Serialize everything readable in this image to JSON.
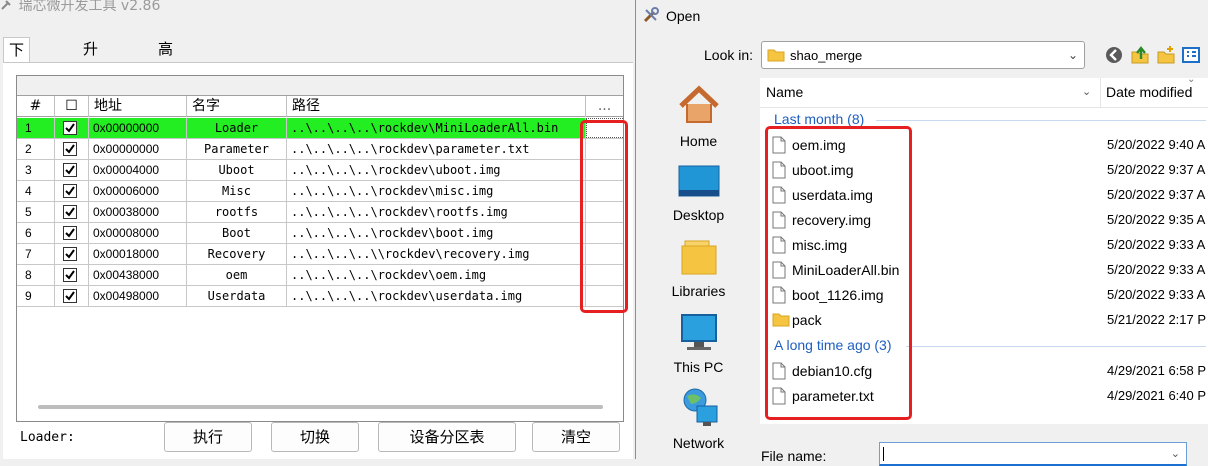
{
  "tool": {
    "title": "瑞芯微开发工具 v2.86",
    "tabs": [
      "下载镜像",
      "升级固件",
      "高级功能"
    ],
    "columns": {
      "num": "#",
      "check": "☐",
      "addr": "地址",
      "name": "名字",
      "path": "路径",
      "extra": "..."
    },
    "rows": [
      {
        "num": "1",
        "addr": "0x00000000",
        "name": "Loader",
        "path": "..\\..\\..\\..\\rockdev\\MiniLoaderAll.bin",
        "checked": true,
        "selected": true
      },
      {
        "num": "2",
        "addr": "0x00000000",
        "name": "Parameter",
        "path": "..\\..\\..\\..\\rockdev\\parameter.txt",
        "checked": true
      },
      {
        "num": "3",
        "addr": "0x00004000",
        "name": "Uboot",
        "path": "..\\..\\..\\..\\rockdev\\uboot.img",
        "checked": true
      },
      {
        "num": "4",
        "addr": "0x00006000",
        "name": "Misc",
        "path": "..\\..\\..\\..\\rockdev\\misc.img",
        "checked": true
      },
      {
        "num": "5",
        "addr": "0x00038000",
        "name": "rootfs",
        "path": "..\\..\\..\\..\\rockdev\\rootfs.img",
        "checked": true
      },
      {
        "num": "6",
        "addr": "0x00008000",
        "name": "Boot",
        "path": "..\\..\\..\\..\\rockdev\\boot.img",
        "checked": true
      },
      {
        "num": "7",
        "addr": "0x00018000",
        "name": "Recovery",
        "path": "..\\..\\..\\..\\\\rockdev\\recovery.img",
        "checked": true
      },
      {
        "num": "8",
        "addr": "0x00438000",
        "name": "oem",
        "path": "..\\..\\..\\..\\rockdev\\oem.img",
        "checked": true
      },
      {
        "num": "9",
        "addr": "0x00498000",
        "name": "Userdata",
        "path": "..\\..\\..\\..\\rockdev\\userdata.img",
        "checked": true
      }
    ],
    "loader_label": "Loader:",
    "buttons": {
      "run": "执行",
      "switch": "切换",
      "partition": "设备分区表",
      "clear": "清空"
    },
    "colors": {
      "selected_row": "#22ee22",
      "highlight_box": "#e62020"
    }
  },
  "dialog": {
    "title": "Open",
    "look_in_label": "Look in:",
    "look_in_value": "shao_merge",
    "places": [
      "Home",
      "Desktop",
      "Libraries",
      "This PC",
      "Network"
    ],
    "columns": {
      "name": "Name",
      "date": "Date modified"
    },
    "groups": [
      {
        "label": "Last month (8)",
        "files": [
          {
            "name": "oem.img",
            "date": "5/20/2022 9:40 A",
            "type": "file"
          },
          {
            "name": "uboot.img",
            "date": "5/20/2022 9:37 A",
            "type": "file"
          },
          {
            "name": "userdata.img",
            "date": "5/20/2022 9:37 A",
            "type": "file"
          },
          {
            "name": "recovery.img",
            "date": "5/20/2022 9:35 A",
            "type": "file"
          },
          {
            "name": "misc.img",
            "date": "5/20/2022 9:33 A",
            "type": "file"
          },
          {
            "name": "MiniLoaderAll.bin",
            "date": "5/20/2022 9:33 A",
            "type": "file"
          },
          {
            "name": "boot_1126.img",
            "date": "5/20/2022 9:33 A",
            "type": "file"
          },
          {
            "name": "pack",
            "date": "5/21/2022 2:17 P",
            "type": "folder"
          }
        ]
      },
      {
        "label": "A long time ago (3)",
        "files": [
          {
            "name": "debian10.cfg",
            "date": "4/29/2021 6:58 P",
            "type": "file"
          },
          {
            "name": "parameter.txt",
            "date": "4/29/2021 6:40 P",
            "type": "file"
          }
        ]
      }
    ],
    "file_name_label": "File name:",
    "file_name_value": "",
    "icons": [
      "back-icon",
      "up-folder-icon",
      "new-folder-icon",
      "view-menu-icon"
    ]
  }
}
